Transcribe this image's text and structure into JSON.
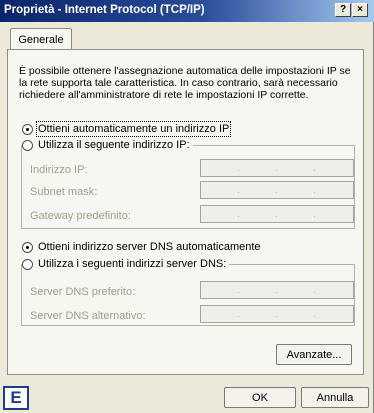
{
  "window": {
    "title": "Proprietà - Internet Protocol (TCP/IP)",
    "help_label": "?",
    "close_label": "×"
  },
  "tabs": [
    {
      "label": "Generale"
    }
  ],
  "info_text": "È possibile ottenere l'assegnazione automatica delle impostazioni IP se la rete supporta tale caratteristica. In caso contrario, sarà necessario richiedere all'amministratore di rete le impostazioni IP corrette.",
  "ip_section": {
    "auto_label": "Ottieni automaticamente un indirizzo IP",
    "auto_selected": true,
    "manual_label": "Utilizza il seguente indirizzo IP:",
    "manual_selected": false,
    "fields": [
      {
        "label": "Indirizzo IP:",
        "value": ""
      },
      {
        "label": "Subnet mask:",
        "value": ""
      },
      {
        "label": "Gateway predefinito:",
        "value": ""
      }
    ]
  },
  "dns_section": {
    "auto_label": "Ottieni indirizzo server DNS automaticamente",
    "auto_selected": true,
    "manual_label": "Utilizza i seguenti indirizzi server DNS:",
    "manual_selected": false,
    "fields": [
      {
        "label": "Server DNS preferito:",
        "value": ""
      },
      {
        "label": "Server DNS alternativo:",
        "value": ""
      }
    ]
  },
  "buttons": {
    "advanced": "Avanzate...",
    "ok": "OK",
    "cancel": "Annulla"
  },
  "corner_badge": "E",
  "colors": {
    "titlebar_start": "#0a246a",
    "titlebar_end": "#a6caf0",
    "badge": "#1c3c8c"
  }
}
